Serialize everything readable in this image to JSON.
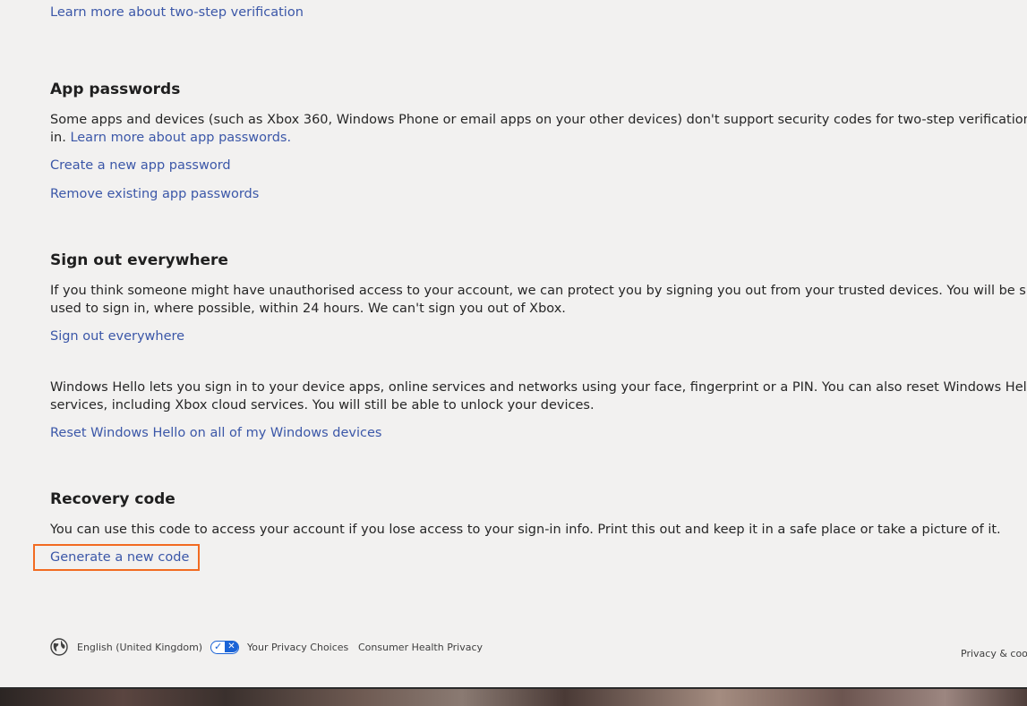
{
  "top_link": "Learn more about two-step verification",
  "app_passwords": {
    "heading": "App passwords",
    "desc_line1": "Some apps and devices (such as Xbox 360, Windows Phone or email apps on your other devices) don't support security codes for two-step verification. In these cases",
    "desc_line2_prefix": "in. ",
    "desc_link": "Learn more about app passwords.",
    "create_link": "Create a new app password",
    "remove_link": "Remove existing app passwords"
  },
  "sign_out": {
    "heading": "Sign out everywhere",
    "desc_line1": "If you think someone might have unauthorised access to your account, we can protect you by signing you out from your trusted devices. You will be signed out of bro",
    "desc_line2": "used to sign in, where possible, within 24 hours. We can't sign you out of Xbox.",
    "link": "Sign out everywhere"
  },
  "windows_hello": {
    "desc_line1": "Windows Hello lets you sign in to your device apps, online services and networks using your face, fingerprint or a PIN. You can also reset Windows Hello so that nobo",
    "desc_line2": "services, including Xbox cloud services. You will still be able to unlock your devices.",
    "link": "Reset Windows Hello on all of my Windows devices"
  },
  "recovery": {
    "heading": "Recovery code",
    "desc": "You can use this code to access your account if you lose access to your sign-in info. Print this out and keep it in a safe place or take a picture of it.",
    "link": "Generate a new code"
  },
  "footer": {
    "language": "English (United Kingdom)",
    "privacy_choices": "Your Privacy Choices",
    "consumer_health": "Consumer Health Privacy",
    "privacy_cookies": "Privacy & cooki"
  },
  "colors": {
    "link": "#3b57a8",
    "highlight": "#f26b21",
    "background": "#f2f1f0"
  }
}
